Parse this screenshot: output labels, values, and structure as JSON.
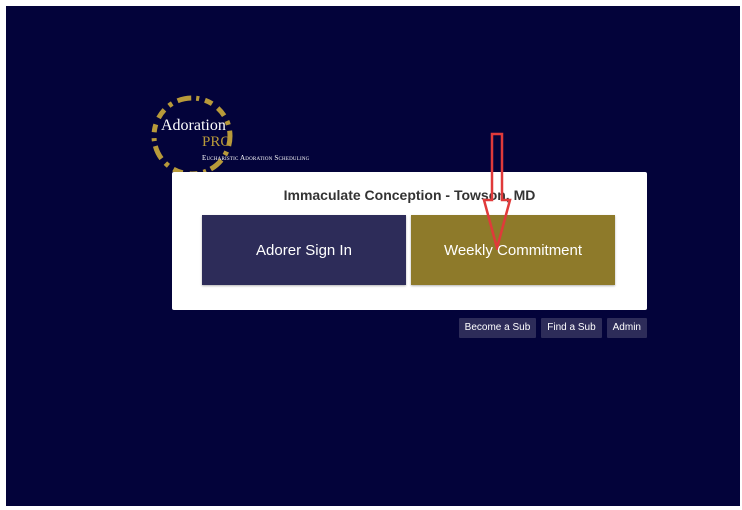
{
  "logo": {
    "word": "Adoration",
    "pro": "PRO",
    "tagline": "Eucharistic Adoration Scheduling"
  },
  "panel": {
    "title": "Immaculate Conception - Towson, MD",
    "signin_label": "Adorer Sign In",
    "weekly_label": "Weekly Commitment"
  },
  "links": {
    "become_sub": "Become a Sub",
    "find_sub": "Find a Sub",
    "admin": "Admin"
  },
  "colors": {
    "background": "#03033a",
    "navy_button": "#2d2c59",
    "gold_button": "#8e7a2a",
    "logo_gold": "#b89a3a",
    "annotation_arrow": "#e03a3a"
  },
  "annotation": {
    "type": "arrow-down",
    "target": "weekly-commitment-button"
  }
}
